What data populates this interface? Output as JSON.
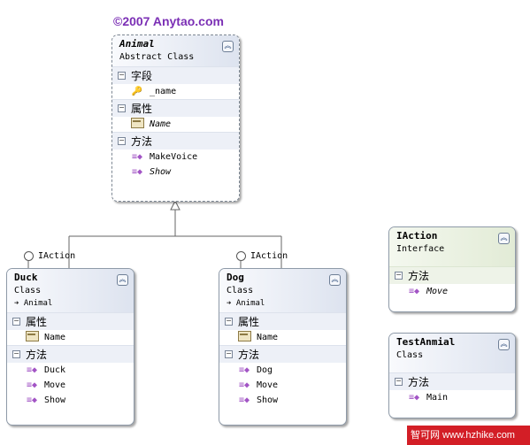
{
  "copyright": "©2007 Anytao.com",
  "classes": {
    "animal": {
      "name": "Animal",
      "kind": "Abstract Class",
      "sections": {
        "fields": {
          "label": "字段",
          "members": [
            "_name"
          ]
        },
        "properties": {
          "label": "属性",
          "members": [
            "Name"
          ]
        },
        "methods": {
          "label": "方法",
          "members": [
            "MakeVoice",
            "Show"
          ]
        }
      }
    },
    "duck": {
      "name": "Duck",
      "kind": "Class",
      "inherits": "Animal",
      "implements": "IAction",
      "sections": {
        "properties": {
          "label": "属性",
          "members": [
            "Name"
          ]
        },
        "methods": {
          "label": "方法",
          "members": [
            "Duck",
            "Move",
            "Show"
          ]
        }
      }
    },
    "dog": {
      "name": "Dog",
      "kind": "Class",
      "inherits": "Animal",
      "implements": "IAction",
      "sections": {
        "properties": {
          "label": "属性",
          "members": [
            "Name"
          ]
        },
        "methods": {
          "label": "方法",
          "members": [
            "Dog",
            "Move",
            "Show"
          ]
        }
      }
    },
    "iaction": {
      "name": "IAction",
      "kind": "Interface",
      "sections": {
        "methods": {
          "label": "方法",
          "members": [
            "Move"
          ]
        }
      }
    },
    "testanmial": {
      "name": "TestAnmial",
      "kind": "Class",
      "sections": {
        "methods": {
          "label": "方法",
          "members": [
            "Main"
          ]
        }
      }
    }
  },
  "watermark": "智可网 www.hzhike.com",
  "colors": {
    "copyright": "#7b2fb5",
    "watermark_bg": "#d31e26",
    "interface_header": "#e2ebd6",
    "class_header": "#dde3ef"
  }
}
